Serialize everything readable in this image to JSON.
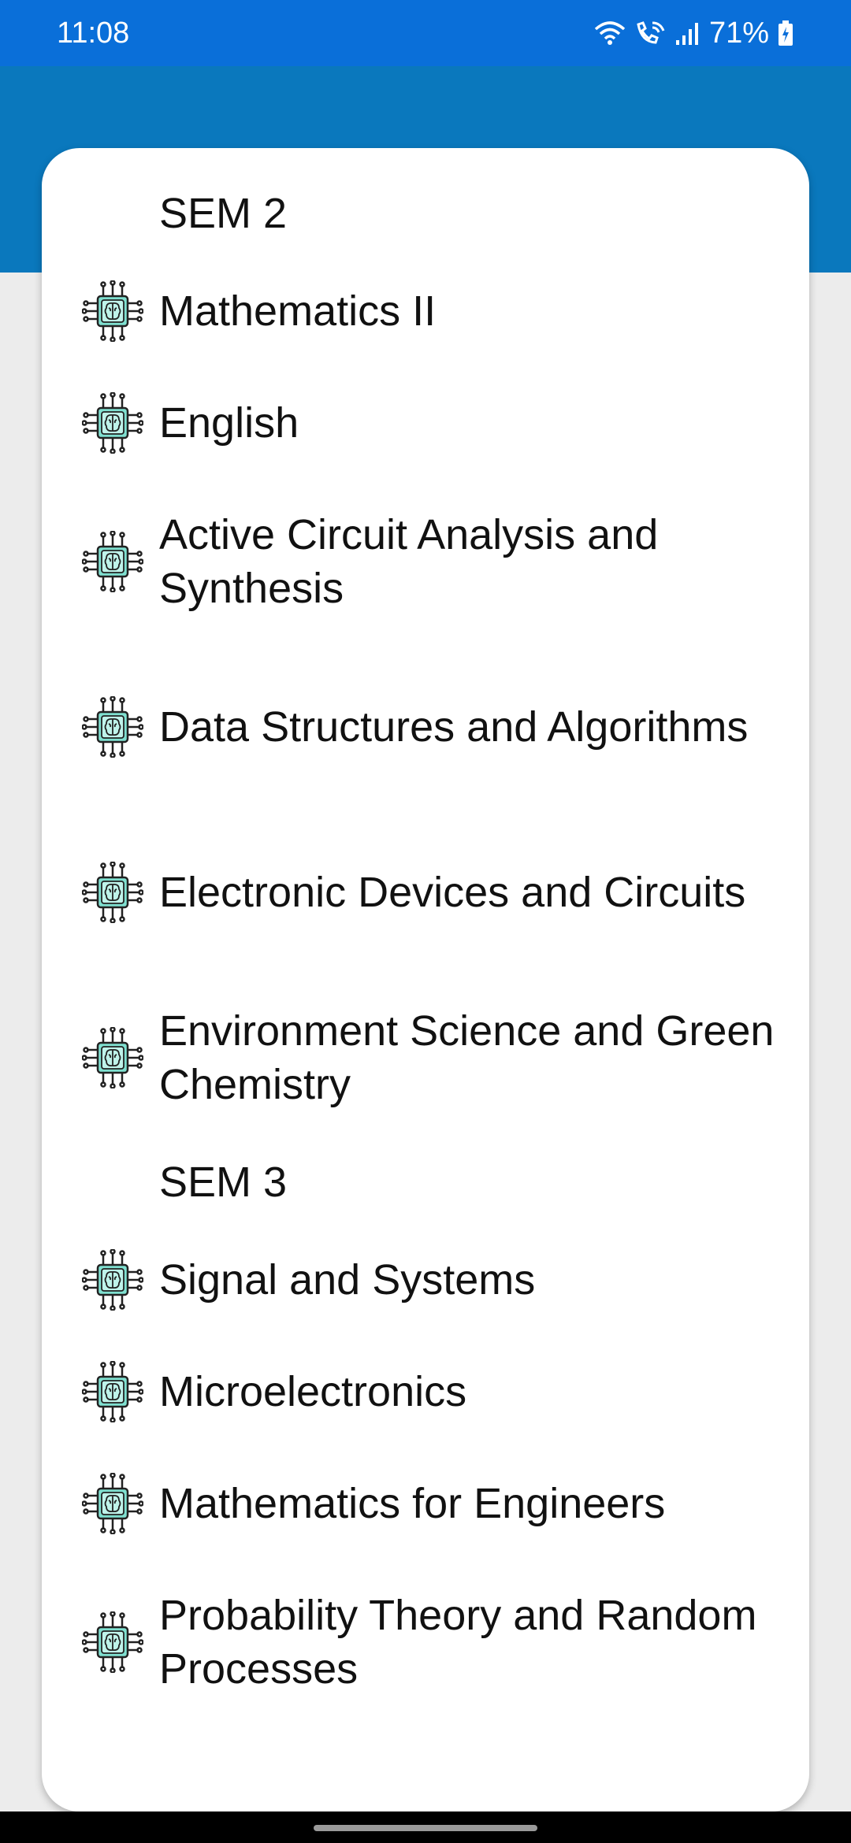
{
  "status_bar": {
    "time": "11:08",
    "battery": "71%",
    "icons": [
      "wifi-icon",
      "wifi-call-icon",
      "signal-icon",
      "battery-charging-icon"
    ]
  },
  "colors": {
    "status_bar": "#0a6fd9",
    "header": "#0a78bd",
    "background": "#ececec",
    "card": "#ffffff",
    "icon_chip": "#7fe0d0"
  },
  "sections": [
    {
      "title": "SEM 2",
      "subjects": [
        "Mathematics II",
        "English",
        "Active Circuit Analysis and Synthesis",
        "Data Structures and Algorithms",
        "Electronic Devices and Circuits",
        "Environment Science and Green Chemistry"
      ]
    },
    {
      "title": "SEM 3",
      "subjects": [
        "Signal and Systems",
        "Microelectronics",
        "Mathematics for Engineers",
        "Probability Theory and Random Processes"
      ]
    }
  ]
}
